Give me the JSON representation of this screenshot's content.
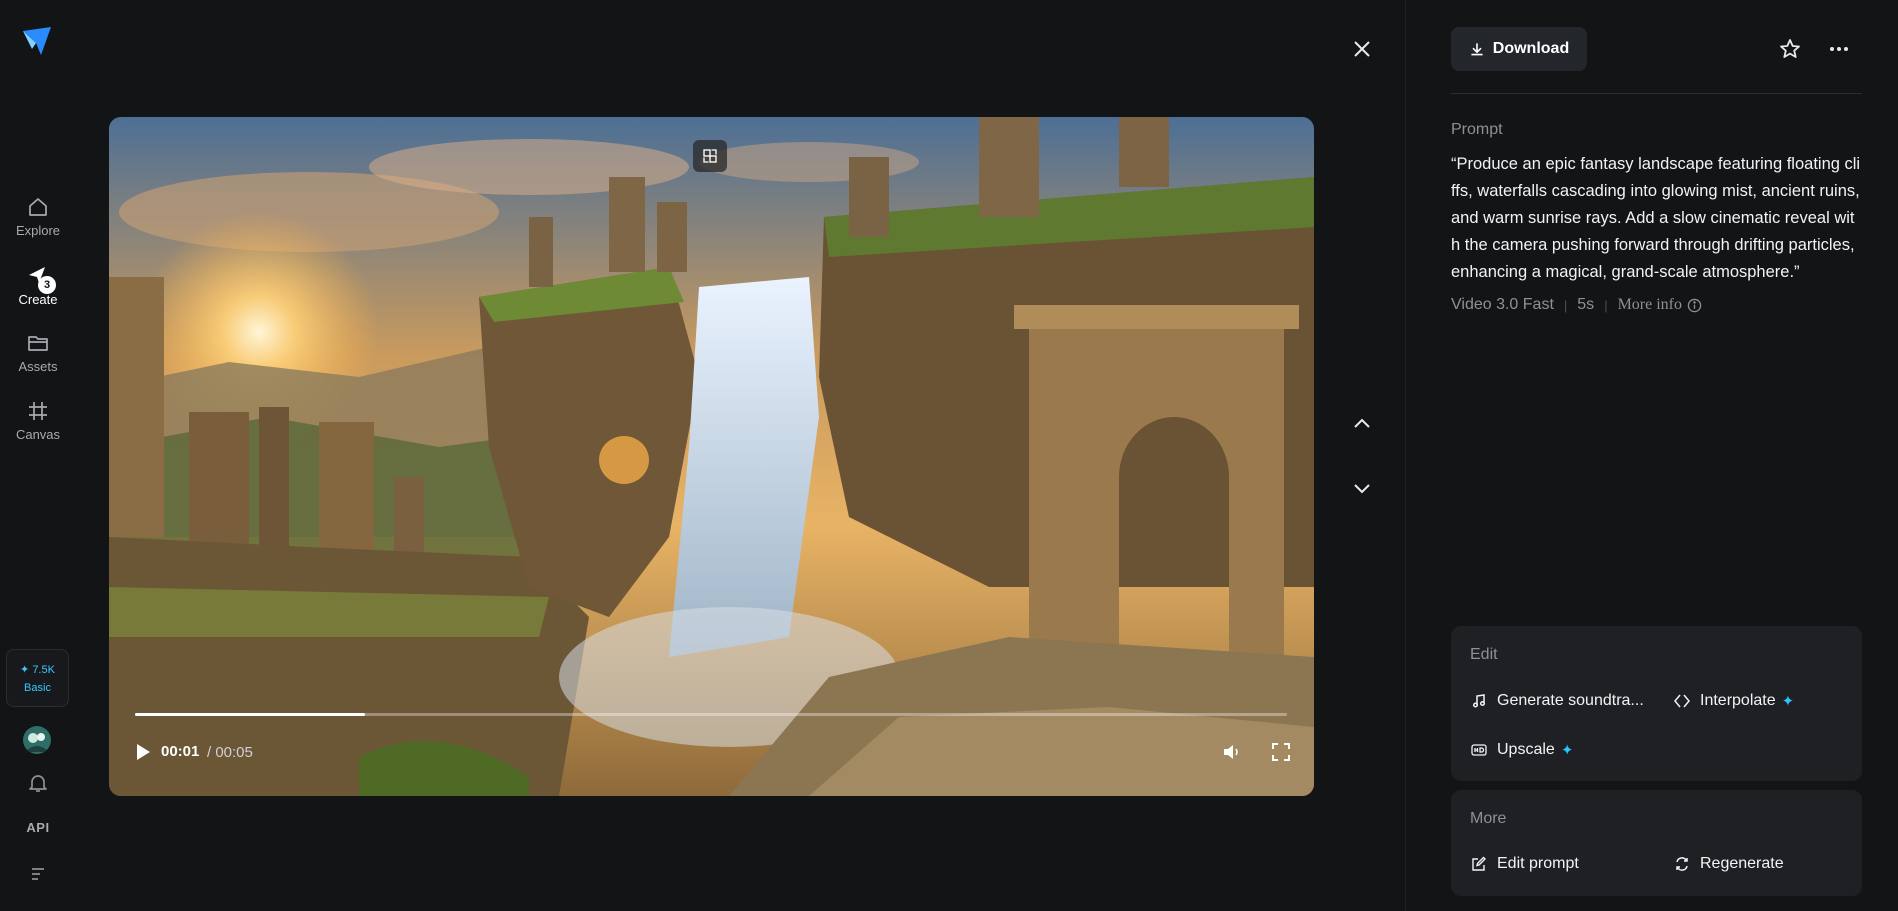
{
  "sidebar": {
    "nav": [
      {
        "label": "Explore",
        "icon": "home-icon"
      },
      {
        "label": "Create",
        "icon": "create-icon",
        "badge": "3",
        "active": true
      },
      {
        "label": "Assets",
        "icon": "folder-icon"
      },
      {
        "label": "Canvas",
        "icon": "canvas-icon"
      }
    ],
    "credits": {
      "amount": "7.5K",
      "plan": "Basic"
    },
    "api_label": "API"
  },
  "player": {
    "current_time": "00:01",
    "total_time": "/ 00:05",
    "progress": 0.2
  },
  "panel": {
    "download_label": "Download",
    "prompt_label": "Prompt",
    "prompt_text": "“Produce an epic fantasy landscape featuring floating cliffs, waterfalls cascading into glowing mist, ancient ruins, and warm sunrise rays. Add a slow cinematic reveal with the camera pushing forward through drifting particles, enhancing a magical, grand-scale atmosphere.”",
    "model": "Video 3.0 Fast",
    "duration": "5s",
    "more_info": "More info",
    "edit": {
      "title": "Edit",
      "actions": [
        {
          "label": "Generate soundtra...",
          "icon": "music-note-icon"
        },
        {
          "label": "Interpolate",
          "icon": "interpolate-icon",
          "premium": true
        },
        {
          "label": "Upscale",
          "icon": "hd-icon",
          "premium": true
        }
      ]
    },
    "more": {
      "title": "More",
      "actions": [
        {
          "label": "Edit prompt",
          "icon": "edit-icon"
        },
        {
          "label": "Regenerate",
          "icon": "regenerate-icon"
        }
      ]
    }
  },
  "colors": {
    "background": "#131416",
    "card": "#1e2024",
    "accent": "#29c3ff"
  }
}
